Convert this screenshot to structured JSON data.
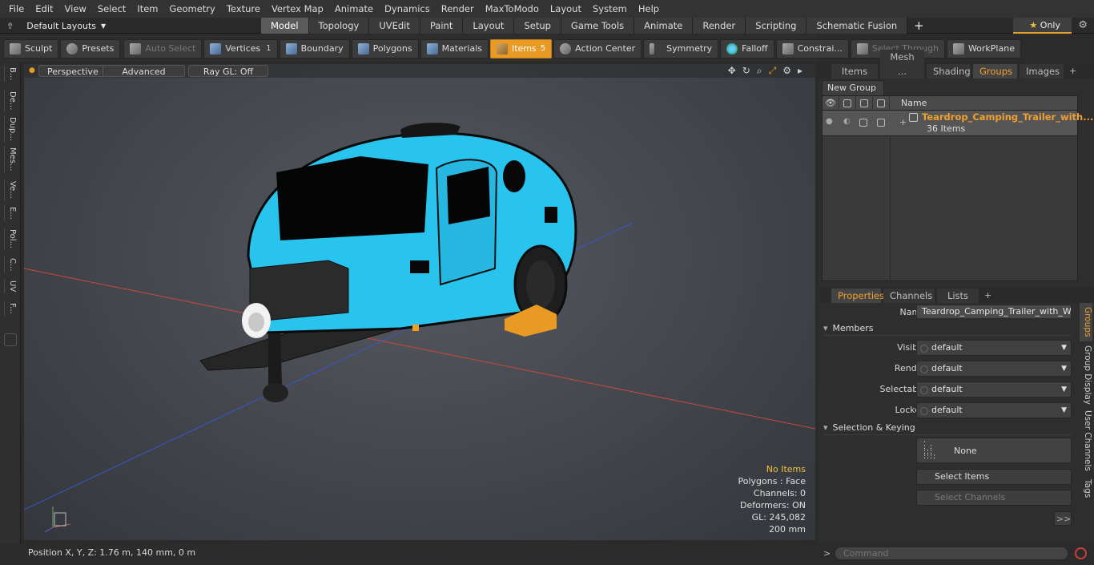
{
  "menu": [
    "File",
    "Edit",
    "View",
    "Select",
    "Item",
    "Geometry",
    "Texture",
    "Vertex Map",
    "Animate",
    "Dynamics",
    "Render",
    "MaxToModo",
    "Layout",
    "System",
    "Help"
  ],
  "layout_selector": "Default Layouts",
  "workspace_tabs": [
    "Model",
    "Topology",
    "UVEdit",
    "Paint",
    "Layout",
    "Setup",
    "Game Tools",
    "Animate",
    "Render",
    "Scripting",
    "Schematic Fusion"
  ],
  "only_label": "Only",
  "toolbar": {
    "sculpt": "Sculpt",
    "presets": "Presets",
    "auto_select": "Auto Select",
    "vertices": "Vertices",
    "vertices_count": "1",
    "boundary": "Boundary",
    "polygons": "Polygons",
    "materials": "Materials",
    "items": "Items",
    "items_count": "5",
    "action_center": "Action Center",
    "symmetry": "Symmetry",
    "falloff": "Falloff",
    "constraints": "Constrai...",
    "select_through": "Select Through",
    "workplane": "WorkPlane"
  },
  "left_tabs": [
    "B...",
    "De...",
    "Dup...",
    "Mes...",
    "Ve...",
    "E...",
    "Pol...",
    "C...",
    "UV",
    "F..."
  ],
  "viewport": {
    "perspective": "Perspective",
    "advanced": "Advanced",
    "raygl": "Ray GL: Off",
    "stats": {
      "items": "No Items",
      "polygons": "Polygons : Face",
      "channels": "Channels: 0",
      "deformers": "Deformers: ON",
      "gl": "GL: 245,082",
      "scale": "200 mm"
    }
  },
  "status": {
    "position": "Position X, Y, Z:  1.76 m, 140 mm, 0 m"
  },
  "top_panel": {
    "tabs": [
      "Items",
      "Mesh ...",
      "Shading",
      "Groups",
      "Images"
    ],
    "new_group": "New Group",
    "name_header": "Name",
    "group_name": "Teardrop_Camping_Trailer_with...",
    "group_count": "36 Items"
  },
  "props": {
    "tabs": [
      "Properties",
      "Channels",
      "Lists"
    ],
    "name_label": "Name",
    "name_value": "Teardrop_Camping_Trailer_with_Whee",
    "members": "Members",
    "visible_label": "Visible",
    "render_label": "Render",
    "selectable_label": "Selectable",
    "locked_label": "Locked",
    "default": "default",
    "selection_keying": "Selection & Keying",
    "none": "None",
    "select_items": "Select Items",
    "select_channels": "Select Channels",
    "more": ">>"
  },
  "side_tabs": [
    "Groups",
    "Group Display",
    "User Channels",
    "Tags"
  ],
  "command": {
    "placeholder": "Command",
    "prompt": ">"
  },
  "colors": {
    "accent": "#e89a25",
    "trailer": "#29c8f0"
  }
}
